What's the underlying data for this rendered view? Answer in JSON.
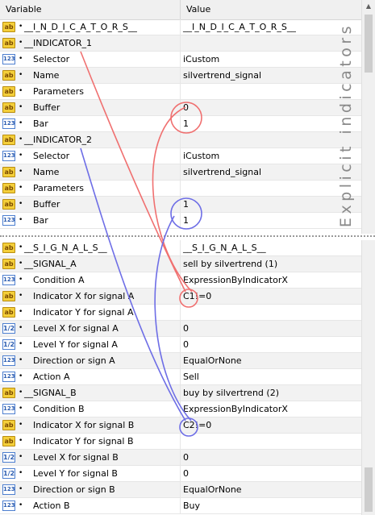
{
  "header": {
    "col_variable": "Variable",
    "col_value": "Value"
  },
  "side_label": "Explicit indicators",
  "top_rows": [
    {
      "icon": "ab",
      "indent": 0,
      "name": "__I_N_D_I_C_A_T_O_R_S__",
      "value": "__I_N_D_I_C_A_T_O_R_S__"
    },
    {
      "icon": "ab",
      "indent": 0,
      "name": "__INDICATOR_1",
      "value": ""
    },
    {
      "icon": "123",
      "indent": 1,
      "name": "Selector",
      "value": "iCustom"
    },
    {
      "icon": "ab",
      "indent": 1,
      "name": "Name",
      "value": "silvertrend_signal"
    },
    {
      "icon": "ab",
      "indent": 1,
      "name": "Parameters",
      "value": ""
    },
    {
      "icon": "ab",
      "indent": 1,
      "name": "Buffer",
      "value": "0"
    },
    {
      "icon": "123",
      "indent": 1,
      "name": "Bar",
      "value": "1"
    },
    {
      "icon": "ab",
      "indent": 0,
      "name": "__INDICATOR_2",
      "value": ""
    },
    {
      "icon": "123",
      "indent": 1,
      "name": "Selector",
      "value": "iCustom"
    },
    {
      "icon": "ab",
      "indent": 1,
      "name": "Name",
      "value": "silvertrend_signal"
    },
    {
      "icon": "ab",
      "indent": 1,
      "name": "Parameters",
      "value": ""
    },
    {
      "icon": "ab",
      "indent": 1,
      "name": "Buffer",
      "value": "1"
    },
    {
      "icon": "123",
      "indent": 1,
      "name": "Bar",
      "value": "1"
    }
  ],
  "bottom_rows": [
    {
      "icon": "ab",
      "indent": 0,
      "name": "__S_I_G_N_A_L_S__",
      "value": "__S_I_G_N_A_L_S__"
    },
    {
      "icon": "ab",
      "indent": 0,
      "name": "__SIGNAL_A",
      "value": "sell by silvertrend (1)"
    },
    {
      "icon": "123",
      "indent": 1,
      "name": "Condition A",
      "value": "ExpressionByIndicatorX"
    },
    {
      "icon": "ab",
      "indent": 1,
      "name": "Indicator X for signal A",
      "value": "C1!=0"
    },
    {
      "icon": "ab",
      "indent": 1,
      "name": "Indicator Y for signal A",
      "value": ""
    },
    {
      "icon": "1/2",
      "indent": 1,
      "name": "Level X for signal A",
      "value": "0"
    },
    {
      "icon": "1/2",
      "indent": 1,
      "name": "Level Y for signal A",
      "value": "0"
    },
    {
      "icon": "123",
      "indent": 1,
      "name": "Direction or sign A",
      "value": "EqualOrNone"
    },
    {
      "icon": "123",
      "indent": 1,
      "name": "Action A",
      "value": "Sell"
    },
    {
      "icon": "ab",
      "indent": 0,
      "name": "__SIGNAL_B",
      "value": "buy by silvertrend (2)"
    },
    {
      "icon": "123",
      "indent": 1,
      "name": "Condition B",
      "value": "ExpressionByIndicatorX"
    },
    {
      "icon": "ab",
      "indent": 1,
      "name": "Indicator X for signal B",
      "value": "C2!=0"
    },
    {
      "icon": "ab",
      "indent": 1,
      "name": "Indicator Y for signal B",
      "value": ""
    },
    {
      "icon": "1/2",
      "indent": 1,
      "name": "Level X for signal B",
      "value": "0"
    },
    {
      "icon": "1/2",
      "indent": 1,
      "name": "Level Y for signal B",
      "value": "0"
    },
    {
      "icon": "123",
      "indent": 1,
      "name": "Direction or sign B",
      "value": "EqualOrNone"
    },
    {
      "icon": "123",
      "indent": 1,
      "name": "Action B",
      "value": "Buy"
    }
  ],
  "colors": {
    "red_annotation": "#f07070",
    "blue_annotation": "#6e6ee6",
    "side_label": "#8a8a8a"
  }
}
